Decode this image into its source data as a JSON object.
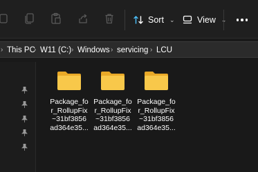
{
  "toolbar": {
    "sort_label": "Sort",
    "view_label": "View",
    "icons": [
      "cut-icon",
      "copy-icon",
      "paste-icon",
      "share-icon",
      "delete-icon"
    ]
  },
  "address": {
    "crumbs": [
      "This PC",
      "W11 (C:)",
      "Windows",
      "servicing",
      "LCU"
    ]
  },
  "files": [
    {
      "name_lines": [
        "Package_fo",
        "r_RollupFix",
        "~31bf3856",
        "ad364e35..."
      ]
    },
    {
      "name_lines": [
        "Package_fo",
        "r_RollupFix",
        "~31bf3856",
        "ad364e35..."
      ]
    },
    {
      "name_lines": [
        "Package_fo",
        "r_RollupFix",
        "~31bf3856",
        "ad364e35..."
      ]
    }
  ],
  "colors": {
    "folder_front": "#f8c84a",
    "folder_back": "#e9a928",
    "accent": "#4cc2ff"
  }
}
